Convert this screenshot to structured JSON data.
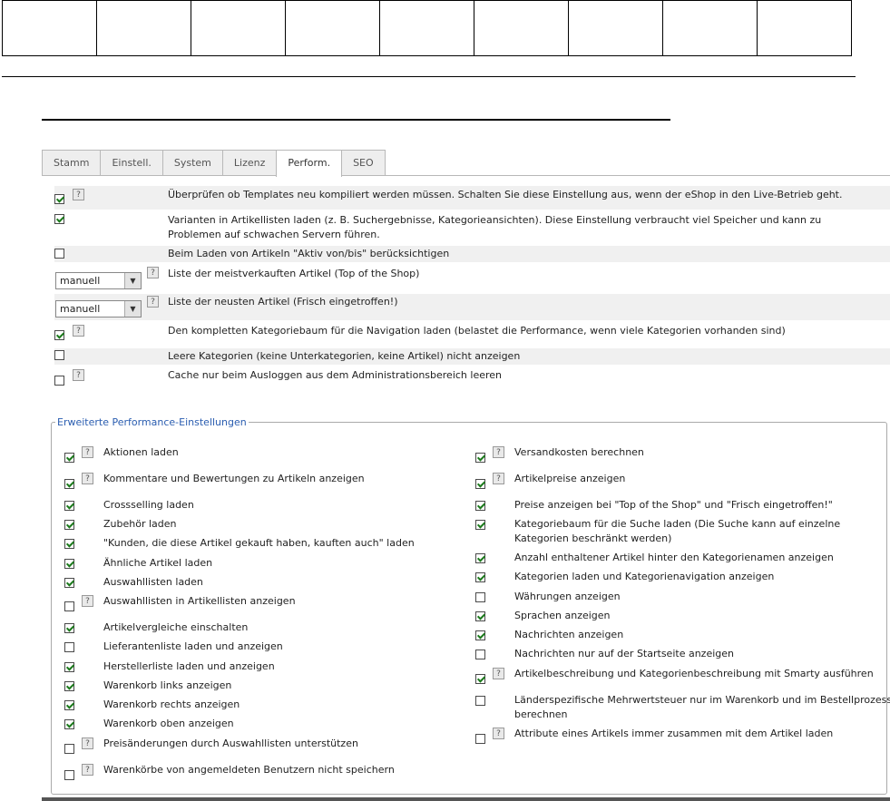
{
  "tabs": [
    "Stamm",
    "Einstell.",
    "System",
    "Lizenz",
    "Perform.",
    "SEO"
  ],
  "active_tab": "Perform.",
  "main_settings": [
    {
      "checked": true,
      "help": true,
      "text": "Überprüfen ob Templates neu kompiliert werden müssen. Schalten Sie diese Einstellung aus, wenn der eShop in den Live-Betrieb geht."
    },
    {
      "checked": true,
      "help": false,
      "text": "Varianten in Artikellisten laden (z. B. Suchergebnisse, Kategorieansichten). Diese Einstellung verbraucht viel Speicher und kann zu Problemen auf schwachen Servern führen."
    },
    {
      "checked": false,
      "help": false,
      "text": "Beim Laden von Artikeln \"Aktiv von/bis\" berücksichtigen"
    },
    {
      "select": "manuell",
      "help": true,
      "text": "Liste der meistverkauften Artikel (Top of the Shop)"
    },
    {
      "select": "manuell",
      "help": true,
      "text": "Liste der neusten Artikel (Frisch eingetroffen!)"
    },
    {
      "checked": true,
      "help": true,
      "text": "Den kompletten Kategoriebaum für die Navigation laden (belastet die Performance, wenn viele Kategorien vorhanden sind)"
    },
    {
      "checked": false,
      "help": false,
      "text": "Leere Kategorien (keine Unterkategorien, keine Artikel) nicht anzeigen"
    },
    {
      "checked": false,
      "help": true,
      "text": "Cache nur beim Ausloggen aus dem Administrationsbereich leeren"
    }
  ],
  "advanced": {
    "legend": "Erweiterte Performance-Einstellungen",
    "left": [
      {
        "checked": true,
        "help": true,
        "text": "Aktionen laden"
      },
      {
        "checked": true,
        "help": true,
        "text": "Kommentare und Bewertungen zu Artikeln anzeigen"
      },
      {
        "checked": true,
        "help": false,
        "text": "Crossselling laden"
      },
      {
        "checked": true,
        "help": false,
        "text": "Zubehör laden"
      },
      {
        "checked": true,
        "help": false,
        "text": "\"Kunden, die diese Artikel gekauft haben, kauften auch\" laden"
      },
      {
        "checked": true,
        "help": false,
        "text": "Ähnliche Artikel laden"
      },
      {
        "checked": true,
        "help": false,
        "text": "Auswahllisten laden"
      },
      {
        "checked": false,
        "help": true,
        "text": "Auswahllisten in Artikellisten anzeigen"
      },
      {
        "checked": true,
        "help": false,
        "text": "Artikelvergleiche einschalten"
      },
      {
        "checked": false,
        "help": false,
        "text": "Lieferantenliste laden und anzeigen"
      },
      {
        "checked": true,
        "help": false,
        "text": "Herstellerliste laden und anzeigen"
      },
      {
        "checked": true,
        "help": false,
        "text": "Warenkorb links anzeigen"
      },
      {
        "checked": true,
        "help": false,
        "text": "Warenkorb rechts anzeigen"
      },
      {
        "checked": true,
        "help": false,
        "text": "Warenkorb oben anzeigen"
      },
      {
        "checked": false,
        "help": true,
        "text": "Preisänderungen durch Auswahllisten unterstützen"
      },
      {
        "checked": false,
        "help": true,
        "text": "Warenkörbe von angemeldeten Benutzern nicht speichern"
      }
    ],
    "right": [
      {
        "checked": true,
        "help": true,
        "text": "Versandkosten berechnen"
      },
      {
        "checked": true,
        "help": true,
        "text": "Artikelpreise anzeigen"
      },
      {
        "checked": true,
        "help": false,
        "text": "Preise anzeigen bei \"Top of the Shop\" und \"Frisch eingetroffen!\""
      },
      {
        "checked": true,
        "help": false,
        "text": "Kategoriebaum für die Suche laden (Die Suche kann auf einzelne Kategorien beschränkt werden)"
      },
      {
        "checked": true,
        "help": false,
        "text": "Anzahl enthaltener Artikel hinter den Kategorienamen anzeigen"
      },
      {
        "checked": true,
        "help": false,
        "text": "Kategorien laden und Kategorienavigation anzeigen"
      },
      {
        "checked": false,
        "help": false,
        "text": "Währungen anzeigen"
      },
      {
        "checked": true,
        "help": false,
        "text": "Sprachen anzeigen"
      },
      {
        "checked": true,
        "help": false,
        "text": "Nachrichten anzeigen"
      },
      {
        "checked": false,
        "help": false,
        "text": "Nachrichten nur auf der Startseite anzeigen"
      },
      {
        "checked": true,
        "help": true,
        "text": "Artikelbeschreibung und Kategorienbeschreibung mit Smarty ausführen"
      },
      {
        "checked": false,
        "help": false,
        "text": "Länderspezifische Mehrwertsteuer nur im Warenkorb und im Bestellprozess berechnen"
      },
      {
        "checked": false,
        "help": true,
        "text": "Attribute eines Artikels immer zusammen mit dem Artikel laden"
      }
    ],
    "help_glyph": "?"
  }
}
